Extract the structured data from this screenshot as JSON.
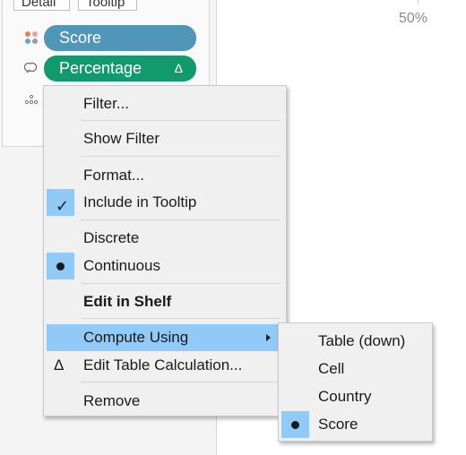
{
  "marks_card": {
    "detail_label": "Detail",
    "tooltip_label": "Tooltip",
    "pills": [
      {
        "label": "Score",
        "color": "#4f96b8"
      },
      {
        "label": "Percentage",
        "color": "#129a6d",
        "badge": "Δ"
      }
    ]
  },
  "axis": {
    "tick_label": "50%"
  },
  "context_menu": {
    "items": [
      {
        "label": "Filter..."
      },
      {
        "label": "Show Filter"
      },
      {
        "label": "Format..."
      },
      {
        "label": "Include in Tooltip",
        "checked": true
      },
      {
        "label": "Discrete"
      },
      {
        "label": "Continuous",
        "selected": true
      },
      {
        "label": "Edit in Shelf",
        "bold": true
      },
      {
        "label": "Compute Using",
        "has_submenu": true,
        "highlighted": true
      },
      {
        "label": "Edit Table Calculation...",
        "icon": "Δ"
      },
      {
        "label": "Remove"
      }
    ]
  },
  "compute_using_submenu": {
    "items": [
      {
        "label": "Table (down)"
      },
      {
        "label": "Cell"
      },
      {
        "label": "Country"
      },
      {
        "label": "Score",
        "selected": true
      }
    ]
  },
  "colors": {
    "highlight": "#91c9f7",
    "menu_bg": "#f0f0f0"
  }
}
